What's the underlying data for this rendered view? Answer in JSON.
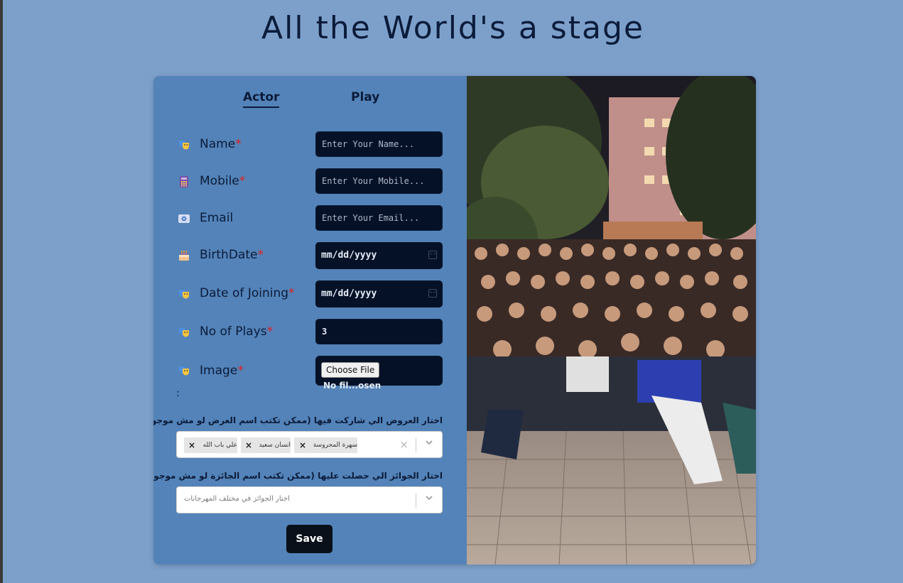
{
  "page": {
    "title": "All the World's a stage"
  },
  "tabs": [
    {
      "label": "Actor",
      "active": true
    },
    {
      "label": "Play",
      "active": false
    }
  ],
  "fields": {
    "name": {
      "label": "Name",
      "required_mark": "*",
      "icon": "theater-masks-icon",
      "placeholder": "Enter Your Name..."
    },
    "mobile": {
      "label": "Mobile",
      "required_mark": "*",
      "icon": "calculator-icon",
      "placeholder": "Enter Your Mobile..."
    },
    "email": {
      "label": "Email",
      "icon": "email-icon",
      "placeholder": "Enter Your Email..."
    },
    "birthdate": {
      "label": "BirthDate",
      "required_mark": "*",
      "icon": "birthday-cake-icon",
      "value": "mm/dd/yyyy"
    },
    "date_of_joining": {
      "label": "Date of Joining",
      "required_mark": "*",
      "icon": "theater-masks-icon",
      "value": "mm/dd/yyyy"
    },
    "no_of_plays": {
      "label": "No of Plays",
      "required_mark": "*",
      "icon": "theater-masks-icon",
      "value": "3"
    },
    "image": {
      "label": "Image",
      "required_mark": "*",
      "icon": "theater-masks-icon",
      "button_label": "Choose File",
      "file_text": "No fil...osen"
    }
  },
  "colon": ":",
  "plays_select": {
    "label": "اختار العروض الي شاركت فيها (ممكن تكتب اسم العرض لو مش موجود)",
    "tags": [
      "سهرة المحروسة",
      "انسان سعيد",
      "علي باب الله"
    ],
    "clear_icon": "×"
  },
  "awards_select": {
    "label": "اختار الجوائز الي حصلت عليها (ممكن تكتب اسم الجائزة لو مش موجودة)",
    "placeholder": "اختار الجوائز في مختلف المهرجانات"
  },
  "save_label": "Save",
  "colors": {
    "background": "#7da0cb",
    "form_panel": "#5383b8",
    "input_bg": "#041127",
    "title": "#0b1b3a",
    "required": "#e02020"
  }
}
